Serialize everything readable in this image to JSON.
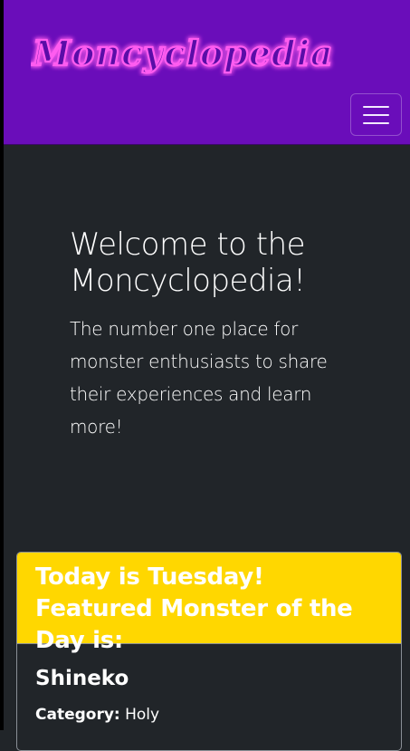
{
  "navbar": {
    "brand_text": "Moncyclopedia",
    "toggle_label": "Toggle navigation"
  },
  "hero": {
    "title": "Welcome to the Moncyclopedia!",
    "subtitle": "The number one place for monster enthusiasts to share their experiences and learn more!"
  },
  "featured": {
    "header": "Today is Tuesday! Featured Monster of the Day is:",
    "monster_name": "Shineko",
    "category_label": "Category:",
    "category_value": "Holy"
  },
  "colors": {
    "navbar_bg": "#6a0dba",
    "page_bg": "#212529",
    "card_header_bg": "#ffd700",
    "logo_fill": "#6a0dba",
    "logo_glow": "#e040fb"
  }
}
